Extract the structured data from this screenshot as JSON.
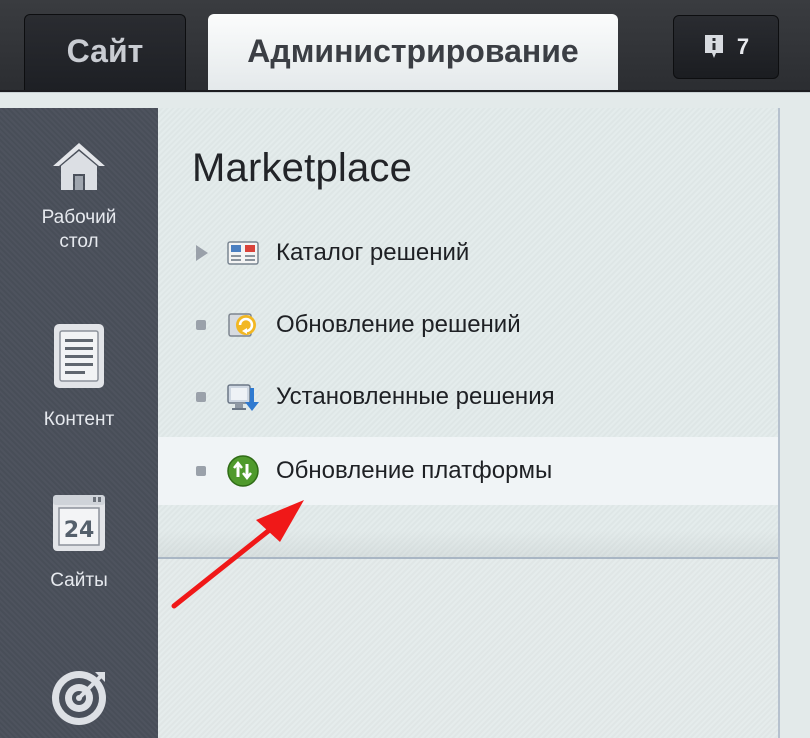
{
  "tabs": {
    "site": "Сайт",
    "admin": "Администрирование"
  },
  "notifications": {
    "icon": "info-notification-icon",
    "count": "7"
  },
  "sidebar": {
    "items": [
      {
        "label_line1": "Рабочий",
        "label_line2": "стол",
        "icon": "house-icon"
      },
      {
        "label": "Контент",
        "icon": "document-icon"
      },
      {
        "label": "Сайты",
        "icon": "calendar-24-icon"
      },
      {
        "label": "",
        "icon": "target-icon"
      }
    ]
  },
  "panel": {
    "title": "Marketplace",
    "items": [
      {
        "label": "Каталог решений",
        "marker": "expand-arrow",
        "icon": "catalog-icon"
      },
      {
        "label": "Обновление решений",
        "marker": "bullet",
        "icon": "update-solutions-icon"
      },
      {
        "label": "Установленные решения",
        "marker": "bullet",
        "icon": "installed-solutions-icon"
      },
      {
        "label": "Обновление платформы",
        "marker": "bullet",
        "icon": "platform-update-icon",
        "highlighted": true
      }
    ]
  },
  "colors": {
    "annotation_arrow": "#f01818",
    "accent_green": "#4f9a2c"
  }
}
